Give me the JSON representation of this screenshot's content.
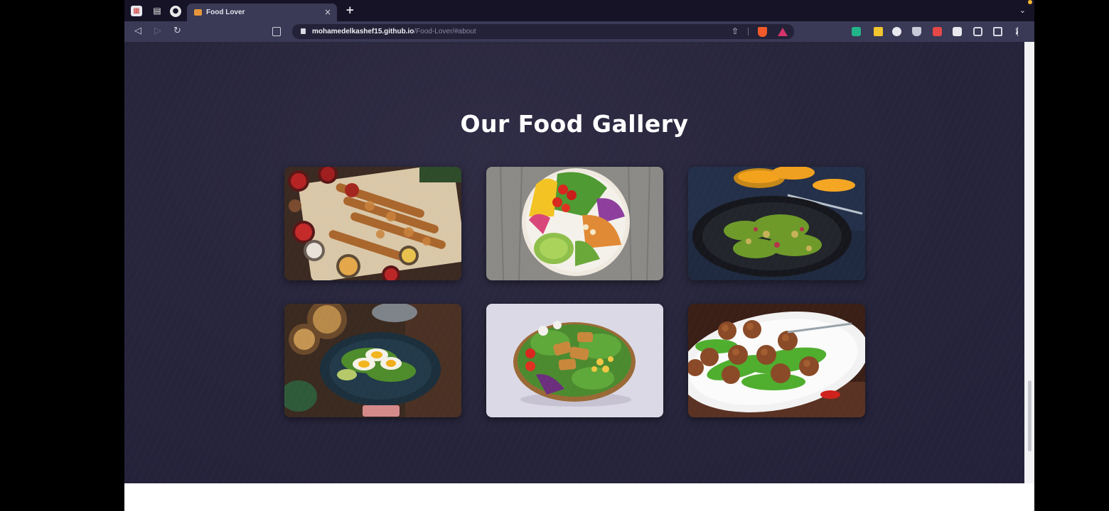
{
  "browser": {
    "tab": {
      "title": "Food Lover",
      "close_glyph": "×"
    },
    "new_tab_glyph": "+",
    "tab_menu_glyph": "⌄",
    "url": {
      "host": "mohamedelkashef15.github.io",
      "path": "/Food-Lover/#about"
    },
    "icons": {
      "back": "arrow-left-icon",
      "forward": "arrow-right-icon",
      "reload": "reload-icon",
      "bookmark": "bookmark-icon",
      "lock": "lock-icon",
      "share": "share-icon",
      "brave_shield": "brave-shield-icon",
      "rewards": "brave-rewards-icon"
    }
  },
  "page": {
    "gallery_title": "Our Food Gallery",
    "gallery": [
      {
        "id": "photo-1",
        "subject": "kebab-platter"
      },
      {
        "id": "photo-2",
        "subject": "salad-bowl"
      },
      {
        "id": "photo-3",
        "subject": "green-salad-plate"
      },
      {
        "id": "photo-4",
        "subject": "egg-avocado-plate"
      },
      {
        "id": "photo-5",
        "subject": "chicken-salad-bowl"
      },
      {
        "id": "photo-6",
        "subject": "meatballs-plate"
      }
    ]
  },
  "colors": {
    "page_bg": "#28263c",
    "tabstrip_bg": "#171327",
    "toolbar_bg": "#3a3956",
    "title_text": "#ffffff"
  }
}
